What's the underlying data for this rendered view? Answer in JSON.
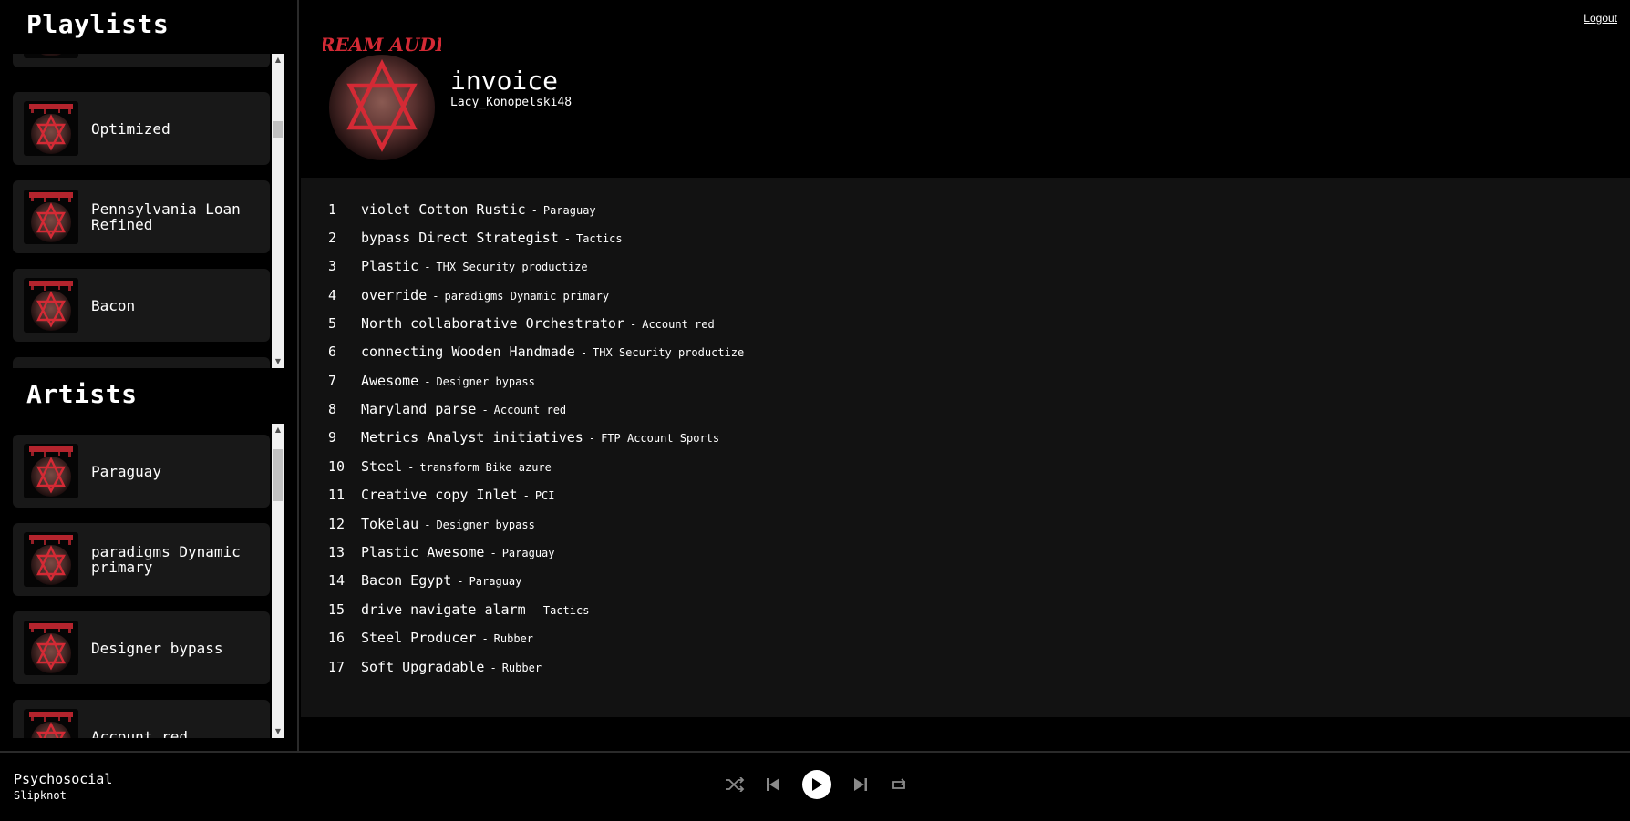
{
  "sidebar": {
    "playlists_title": "Playlists",
    "playlists": [
      {
        "label": ""
      },
      {
        "label": "Optimized"
      },
      {
        "label": "Pennsylvania Loan Refined"
      },
      {
        "label": "Bacon"
      }
    ],
    "artists_title": "Artists",
    "artists": [
      {
        "label": "Paraguay"
      },
      {
        "label": "paradigms Dynamic primary"
      },
      {
        "label": "Designer bypass"
      },
      {
        "label": "Account red"
      }
    ]
  },
  "header": {
    "playlist_title": "invoice",
    "owner": "Lacy_Konopelski48",
    "logout_label": "Logout",
    "cover_text": "DREAM AUDIO"
  },
  "tracks": [
    {
      "num": "1",
      "name": "violet Cotton Rustic",
      "artist": "Paraguay"
    },
    {
      "num": "2",
      "name": "bypass Direct Strategist",
      "artist": "Tactics"
    },
    {
      "num": "3",
      "name": "Plastic",
      "artist": "THX Security productize"
    },
    {
      "num": "4",
      "name": "override",
      "artist": "paradigms Dynamic primary"
    },
    {
      "num": "5",
      "name": "North collaborative Orchestrator",
      "artist": "Account red"
    },
    {
      "num": "6",
      "name": "connecting Wooden Handmade",
      "artist": "THX Security productize"
    },
    {
      "num": "7",
      "name": "Awesome",
      "artist": "Designer bypass"
    },
    {
      "num": "8",
      "name": "Maryland parse",
      "artist": "Account red"
    },
    {
      "num": "9",
      "name": "Metrics Analyst initiatives",
      "artist": "FTP Account Sports"
    },
    {
      "num": "10",
      "name": "Steel",
      "artist": "transform Bike azure"
    },
    {
      "num": "11",
      "name": "Creative copy Inlet",
      "artist": "PCI"
    },
    {
      "num": "12",
      "name": "Tokelau",
      "artist": "Designer bypass"
    },
    {
      "num": "13",
      "name": "Plastic Awesome",
      "artist": "Paraguay"
    },
    {
      "num": "14",
      "name": "Bacon Egypt",
      "artist": "Paraguay"
    },
    {
      "num": "15",
      "name": "drive navigate alarm",
      "artist": "Tactics"
    },
    {
      "num": "16",
      "name": "Steel Producer",
      "artist": "Rubber"
    },
    {
      "num": "17",
      "name": "Soft Upgradable",
      "artist": "Rubber"
    }
  ],
  "track_separator": "-",
  "player": {
    "now_title": "Psychosocial",
    "now_artist": "Slipknot",
    "controls": [
      "shuffle-icon",
      "previous-icon",
      "play-icon",
      "next-icon",
      "repeat-icon"
    ]
  },
  "colors": {
    "background": "#000000",
    "panel": "#121212",
    "card": "#181818",
    "accent": "#d42a35",
    "text": "#ffffff"
  }
}
